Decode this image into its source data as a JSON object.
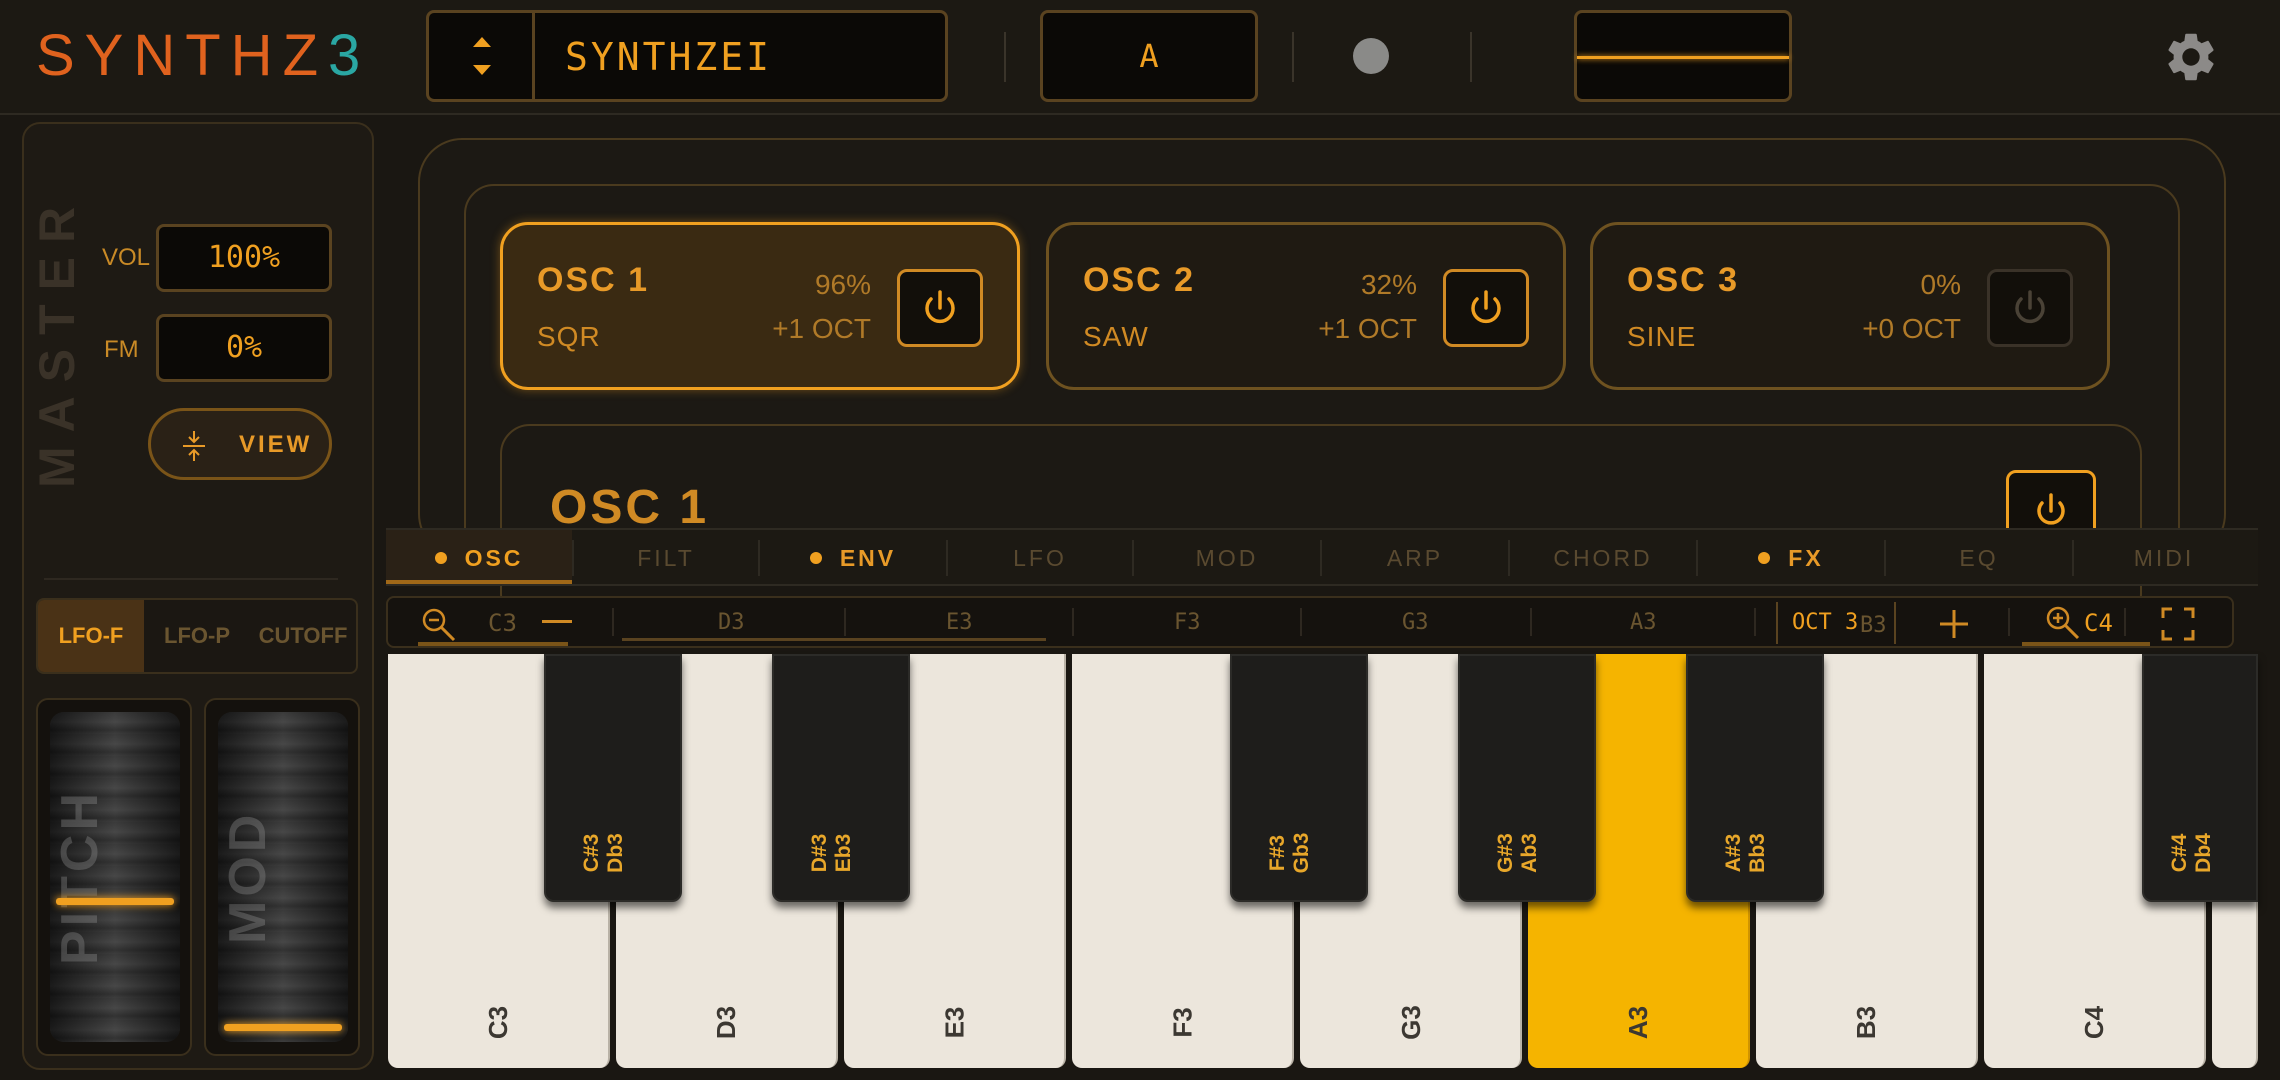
{
  "app": {
    "logo_part1": "SYNTHZ",
    "logo_part2": "3",
    "preset_name": "SYNTHZEI",
    "key_display": "A"
  },
  "master": {
    "title": "MASTER",
    "vol_label": "VOL",
    "vol_value": "100%",
    "fm_label": "FM",
    "fm_value": "0%",
    "view_label": "VIEW",
    "lfo_tabs": [
      "LFO-F",
      "LFO-P",
      "CUTOFF"
    ],
    "lfo_selected": "LFO-F",
    "pitch_label": "PITCH",
    "mod_label": "MOD"
  },
  "oscillators": [
    {
      "name": "OSC 1",
      "wave": "SQR",
      "level": "96%",
      "octave": "+1 OCT",
      "on": true,
      "selected": true
    },
    {
      "name": "OSC 2",
      "wave": "SAW",
      "level": "32%",
      "octave": "+1 OCT",
      "on": true,
      "selected": false
    },
    {
      "name": "OSC 3",
      "wave": "SINE",
      "level": "0%",
      "octave": "+0 OCT",
      "on": false,
      "selected": false
    }
  ],
  "osc_detail_title": "OSC 1",
  "tabs": [
    {
      "label": "OSC",
      "dot": true,
      "selected": true
    },
    {
      "label": "FILT",
      "dot": false
    },
    {
      "label": "ENV",
      "dot": true
    },
    {
      "label": "LFO",
      "dot": false
    },
    {
      "label": "MOD",
      "dot": false
    },
    {
      "label": "ARP",
      "dot": false
    },
    {
      "label": "CHORD",
      "dot": false
    },
    {
      "label": "FX",
      "dot": true
    },
    {
      "label": "EQ",
      "dot": false
    },
    {
      "label": "MIDI",
      "dot": false
    }
  ],
  "strip": {
    "left_note": "C3",
    "notes": [
      "D3",
      "E3",
      "F3",
      "G3",
      "A3",
      "B3"
    ],
    "octave_label": "OCT 3",
    "right_note": "C4"
  },
  "keyboard": {
    "white_keys": [
      "C3",
      "D3",
      "E3",
      "F3",
      "G3",
      "A3",
      "B3",
      "C4"
    ],
    "active_key": "A3",
    "black_keys": [
      {
        "sharp": "C#3",
        "flat": "Db3"
      },
      {
        "sharp": "D#3",
        "flat": "Eb3"
      },
      {
        "sharp": "F#3",
        "flat": "Gb3"
      },
      {
        "sharp": "G#3",
        "flat": "Ab3"
      },
      {
        "sharp": "A#3",
        "flat": "Bb3"
      },
      {
        "sharp": "C#4",
        "flat": "Db4"
      }
    ]
  },
  "colors": {
    "accent": "#f0a020",
    "logo_orange": "#e0621e",
    "logo_teal": "#2aa7a3",
    "background": "#1a1712"
  }
}
